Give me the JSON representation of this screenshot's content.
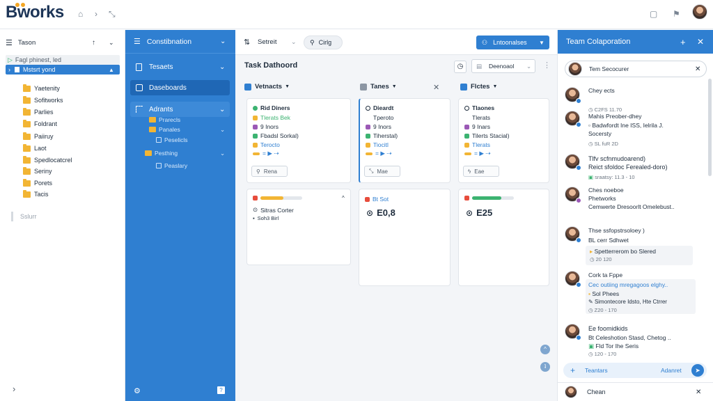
{
  "app": {
    "logo_text": "Bworks"
  },
  "left_panel": {
    "header": "Tason",
    "pinned_row": "Fagl phinest, led",
    "selected_row": "Mstsrt yond",
    "folders": [
      "Yaetenity",
      "Sofitworks",
      "Parlies",
      "Foldrant",
      "Paiiruy",
      "Laot",
      "Spedlocatcrel",
      "Seriny",
      "Porets",
      "Tacis"
    ],
    "footer_label": "Sslurr"
  },
  "blue_panel": {
    "header": "Constibnation",
    "items": [
      {
        "label": "Tesaets"
      },
      {
        "label": "Daseboards"
      },
      {
        "label": "Adrants"
      }
    ],
    "subitems": [
      "Prarecls",
      "Panales",
      "Peselicls",
      "Pesthing",
      "Peaslary"
    ]
  },
  "toolbar": {
    "title": "Setreit",
    "search": "Cirlg",
    "action_button": "Lntoonalses"
  },
  "board": {
    "title": "Task Dathoord",
    "filter": "Deenoaol",
    "columns": [
      {
        "name": "Vetnacts",
        "icon_color": "#2f7fd1"
      },
      {
        "name": "Tanes",
        "icon_color": "#8c96a3"
      },
      {
        "name": "Flctes",
        "icon_color": "#2f7fd1"
      }
    ],
    "cards": [
      {
        "title": "Rid Diners",
        "rows": [
          "Tlerats Bek",
          "9 Inors",
          "Fbadsl Sorkal)",
          "Terocto"
        ],
        "button": "Rena"
      },
      {
        "title": "Dieardt",
        "rows": [
          "Tperoto",
          "9 Inors",
          "Tiherstal)",
          "Tiocitl"
        ],
        "button": "Mae"
      },
      {
        "title": "Tlaones",
        "rows": [
          "Tlerats",
          "9 Inars",
          "Tilerts Stacial)",
          "Tlerats"
        ],
        "button": "Eae"
      }
    ],
    "stats": [
      {
        "label": "Sitras Corter",
        "sub": "Soh3 Birl",
        "value": "",
        "progress": 0.55,
        "color": "#f2b534"
      },
      {
        "label": "Bt Sot",
        "sub": "",
        "value": "E0,8",
        "progress": null,
        "color": "#2f7fd1"
      },
      {
        "label": "",
        "sub": "",
        "value": "E25",
        "progress": 0.7,
        "color": "#3cb371"
      }
    ]
  },
  "team": {
    "header": "Team Colaporation",
    "search": "Tem Secocurer",
    "messages": [
      {
        "name": "Chey ects",
        "lines": [],
        "meta": "C2FS 11.70"
      },
      {
        "name": "Mahis Preober-dhey",
        "lines": [
          "Badwfordt Ine ISS, Ielrila J.",
          "Socersty"
        ],
        "meta": "SL fuR 2D"
      },
      {
        "name": "Tlfv scfnmudoarend)",
        "lines": [
          "Reict sfoldoc Ferealed-doro)"
        ],
        "meta": "sraatsy: 11.3 - 10"
      },
      {
        "name": "Ches noeboe",
        "lines": [
          "Phetworks",
          "Cemwerte Dresoorlt Omelebust.."
        ],
        "meta": ""
      },
      {
        "name": "Thse ssfopstrsoloey )",
        "lines": [
          "BL cerr Sdhwet",
          "Spetterrerom bo Slered"
        ],
        "meta": "20 120"
      },
      {
        "name": "Cork ta Fppe",
        "lines": [
          "Cec outiing mregagoos elghy..",
          "Sol Phees",
          "Simontecore Idsto, Hte Ctrrer"
        ],
        "meta": "Z20 - 170"
      },
      {
        "name": "Ee foomidkids",
        "lines": [
          "Bt Celeshotion Stasd, Chetog ..",
          "Fld Tor Ihe Seris"
        ],
        "meta": "120 - 170"
      }
    ],
    "compose_label": "Teantars",
    "compose_action": "Adanret",
    "footer_name": "Chean"
  }
}
